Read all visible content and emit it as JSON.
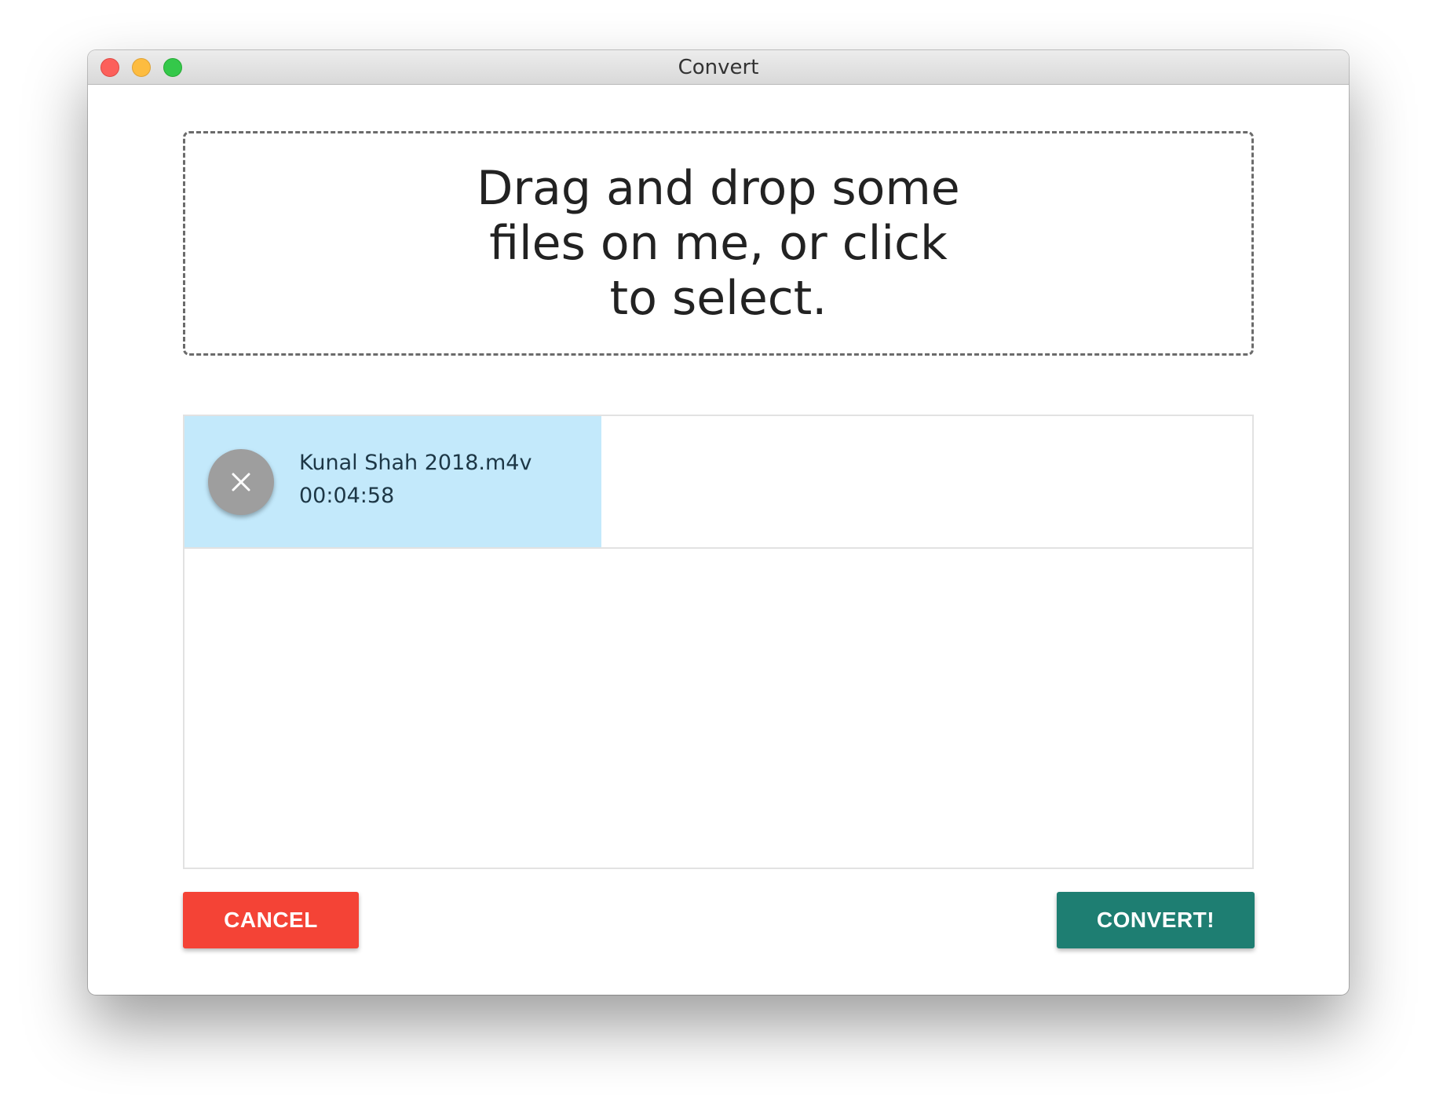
{
  "window": {
    "title": "Convert"
  },
  "dropzone": {
    "text": "Drag and drop some files on me, or click to select."
  },
  "files": [
    {
      "name": "Kunal Shah 2018.m4v",
      "duration": "00:04:58",
      "remove_icon": "close-icon"
    }
  ],
  "actions": {
    "cancel_label": "CANCEL",
    "convert_label": "CONVERT!"
  },
  "colors": {
    "cancel": "#f44336",
    "convert": "#1e7e72",
    "file_highlight": "#c3e9fb",
    "remove_button": "#9e9e9e"
  }
}
